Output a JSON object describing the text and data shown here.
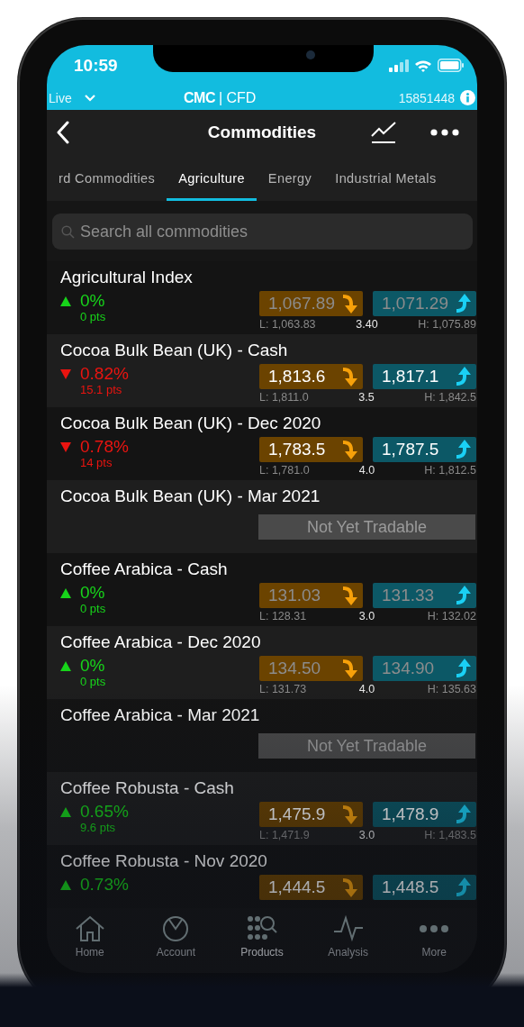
{
  "status_bar": {
    "time": "10:59"
  },
  "account_bar": {
    "mode": "Live",
    "logo": "CMC",
    "product": "| CFD",
    "account_number": "15851448"
  },
  "header": {
    "title": "Commodities"
  },
  "tabs": [
    {
      "label": "rd Commodities",
      "selected": false
    },
    {
      "label": "Agriculture",
      "selected": true
    },
    {
      "label": "Energy",
      "selected": false
    },
    {
      "label": "Industrial Metals",
      "selected": false
    }
  ],
  "search": {
    "placeholder": "Search all commodities"
  },
  "markets": [
    {
      "kind": "priced",
      "name": "Agricultural Index",
      "rising": true,
      "change": "0%",
      "points": "0 pts",
      "sell": "1,067.89",
      "buy": "1,071.29",
      "live": false,
      "low": "L: 1,063.83",
      "spread": "3.40",
      "high": "H: 1,075.89"
    },
    {
      "kind": "priced",
      "name": "Cocoa Bulk Bean (UK) - Cash",
      "rising": false,
      "change": "0.82%",
      "points": "15.1 pts",
      "sell": "1,813.6",
      "buy": "1,817.1",
      "live": true,
      "low": "L: 1,811.0",
      "spread": "3.5",
      "high": "H: 1,842.5"
    },
    {
      "kind": "priced",
      "name": "Cocoa Bulk Bean (UK) - Dec 2020",
      "rising": false,
      "change": "0.78%",
      "points": "14 pts",
      "sell": "1,783.5",
      "buy": "1,787.5",
      "live": true,
      "low": "L: 1,781.0",
      "spread": "4.0",
      "high": "H: 1,812.5"
    },
    {
      "kind": "not_tradable",
      "name": "Cocoa Bulk Bean (UK) - Mar 2021",
      "status": "Not Yet Tradable"
    },
    {
      "kind": "priced",
      "name": "Coffee Arabica - Cash",
      "rising": true,
      "change": "0%",
      "points": "0 pts",
      "sell": "131.03",
      "buy": "131.33",
      "live": false,
      "low": "L: 128.31",
      "spread": "3.0",
      "high": "H: 132.02"
    },
    {
      "kind": "priced",
      "name": "Coffee Arabica - Dec 2020",
      "rising": true,
      "change": "0%",
      "points": "0 pts",
      "sell": "134.50",
      "buy": "134.90",
      "live": false,
      "low": "L: 131.73",
      "spread": "4.0",
      "high": "H: 135.63"
    },
    {
      "kind": "not_tradable",
      "name": "Coffee Arabica - Mar 2021",
      "status": "Not Yet Tradable"
    },
    {
      "kind": "priced",
      "name": "Coffee Robusta - Cash",
      "rising": true,
      "change": "0.65%",
      "points": "9.6 pts",
      "sell": "1,475.9",
      "buy": "1,478.9",
      "live": true,
      "low": "L: 1,471.9",
      "spread": "3.0",
      "high": "H: 1,483.5"
    },
    {
      "kind": "priced",
      "name": "Coffee Robusta - Nov 2020",
      "rising": true,
      "change": "0.73%",
      "sell": "1,444.5",
      "buy": "1,448.5",
      "live": true
    }
  ],
  "bottom_nav": [
    {
      "label": "Home",
      "selected": false
    },
    {
      "label": "Account",
      "selected": false
    },
    {
      "label": "Products",
      "selected": true
    },
    {
      "label": "Analysis",
      "selected": false
    },
    {
      "label": "More",
      "selected": false
    }
  ]
}
